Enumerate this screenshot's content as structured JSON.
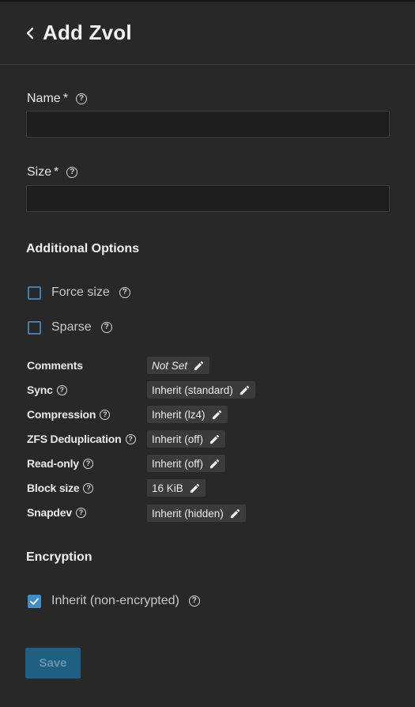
{
  "header": {
    "title": "Add Zvol",
    "back_icon": "chevron-left-icon"
  },
  "fields": {
    "name": {
      "label": "Name",
      "required_mark": "*",
      "value": "",
      "placeholder": ""
    },
    "size": {
      "label": "Size",
      "required_mark": "*",
      "value": "",
      "placeholder": ""
    }
  },
  "additional_options": {
    "title": "Additional Options",
    "force_size": {
      "label": "Force size",
      "checked": false
    },
    "sparse": {
      "label": "Sparse",
      "checked": false
    }
  },
  "properties": [
    {
      "label": "Comments",
      "value": "Not Set",
      "has_help": false
    },
    {
      "label": "Sync",
      "value": "Inherit (standard)",
      "has_help": true
    },
    {
      "label": "Compression",
      "value": "Inherit (lz4)",
      "has_help": true
    },
    {
      "label": "ZFS Deduplication",
      "value": "Inherit (off)",
      "has_help": true
    },
    {
      "label": "Read-only",
      "value": "Inherit (off)",
      "has_help": true
    },
    {
      "label": "Block size",
      "value": "16 KiB",
      "has_help": true
    },
    {
      "label": "Snapdev",
      "value": "Inherit (hidden)",
      "has_help": true
    }
  ],
  "encryption": {
    "title": "Encryption",
    "inherit": {
      "label": "Inherit (non-encrypted)",
      "checked": true
    }
  },
  "actions": {
    "save_label": "Save"
  },
  "colors": {
    "background": "#282828",
    "accent": "#3d8fc8",
    "save_disabled": "#1f5f82"
  }
}
